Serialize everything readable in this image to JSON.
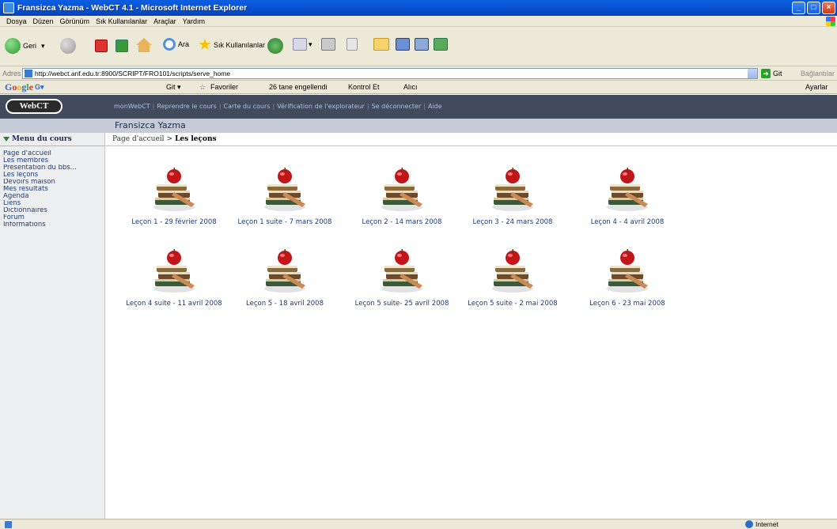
{
  "window": {
    "title": "Fransizca Yazma - WebCT 4.1 - Microsoft Internet Explorer"
  },
  "menu": [
    "Dosya",
    "Düzen",
    "Görünüm",
    "Sık Kullanılanlar",
    "Araçlar",
    "Yardım"
  ],
  "toolbar": {
    "back_label": "Geri",
    "search_label": "Ara",
    "favorites_label": "Sık Kullanılanlar"
  },
  "address": {
    "label": "Adres",
    "url": "http://webct.anf.edu.tr:8900/SCRIPT/FRO101/scripts/serve_home",
    "go_label": "Git",
    "links_label": "Bağlantılar"
  },
  "googlebar": {
    "logo": "Google",
    "go_label": "Git",
    "favorites": "Favoriler",
    "blocked": "26 tane engellendi",
    "check": "Kontrol Et",
    "send": "Alıcı",
    "settings": "Ayarlar"
  },
  "webct": {
    "logo": "WebCT",
    "nav": [
      "monWebCT",
      "Reprendre le cours",
      "Carte du cours",
      "Vérification de l'explorateur",
      "Se déconnecter",
      "Aide"
    ],
    "course_title": "Fransizca Yazma"
  },
  "sidebar": {
    "header": "Menu du cours",
    "items": [
      "Page d'accueil",
      "Les membres",
      "Présentation du bbs...",
      "Les leçons",
      "Devoirs maison",
      "Mes résultats",
      "Agenda",
      "Liens",
      "Dictionnaires",
      "Forum",
      "Informations"
    ]
  },
  "breadcrumb": {
    "home": "Page d'accueil",
    "separator": ">",
    "current": "Les leçons"
  },
  "lessons": [
    "Leçon 1 - 29 février 2008",
    "Leçon 1 suite - 7 mars 2008",
    "Leçon 2 - 14 mars 2008",
    "Leçon 3 - 24 mars 2008",
    "Leçon 4 - 4 avril 2008",
    "Leçon 4 suite - 11 avril 2008",
    "Leçon 5 - 18 avril 2008",
    "Leçon 5 suite- 25 avril 2008",
    "Leçon 5 suite - 2 mai 2008",
    "Leçon 6 - 23 mai 2008"
  ],
  "status": {
    "zone": "Internet"
  }
}
